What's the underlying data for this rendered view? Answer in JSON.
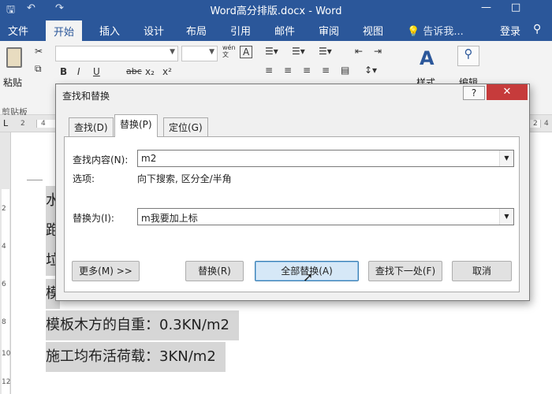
{
  "window": {
    "title": "Word高分排版.docx - Word",
    "quick_access": [
      "↶",
      "↷"
    ],
    "controls": [
      "?",
      "—",
      "□"
    ]
  },
  "ribbon_tabs": [
    {
      "label": "文件"
    },
    {
      "label": "开始"
    },
    {
      "label": "插入"
    },
    {
      "label": "设计"
    },
    {
      "label": "布局"
    },
    {
      "label": "引用"
    },
    {
      "label": "邮件"
    },
    {
      "label": "审阅"
    },
    {
      "label": "视图"
    }
  ],
  "tell_me": "告诉我...",
  "login": "登录",
  "ribbon": {
    "paste_label": "粘贴",
    "clipboard_label": "剪贴板",
    "bold": "B",
    "italic": "I",
    "underline": "U",
    "strike": "abc",
    "subscript": "x₂",
    "superscript": "x²",
    "style_label": "样式",
    "edit_label": "编辑",
    "wen": "wén\n文",
    "a_box": "A"
  },
  "ruler": {
    "numbers": [
      "2",
      "4",
      "2",
      "4"
    ],
    "side_numbers": [
      "2",
      "4",
      "6",
      "8",
      "10",
      "12"
    ]
  },
  "document": {
    "lines": [
      "水",
      "跑",
      "垃",
      "模",
      "模板木方的自重：0.3KN/m2",
      "施工均布活荷载：3KN/m2"
    ]
  },
  "dialog": {
    "title": "查找和替换",
    "help": "?",
    "close": "✕",
    "tabs": [
      {
        "label": "查找(D)"
      },
      {
        "label": "替换(P)"
      },
      {
        "label": "定位(G)"
      }
    ],
    "find_label": "查找内容(N):",
    "find_value": "m2",
    "options_label": "选项:",
    "options_value": "向下搜索, 区分全/半角",
    "replace_label": "替换为(I):",
    "replace_value": "m我要加上标",
    "buttons": {
      "more": "更多(M) >>",
      "replace": "替换(R)",
      "replace_all": "全部替换(A)",
      "find_next": "查找下一处(F)",
      "cancel": "取消"
    }
  }
}
